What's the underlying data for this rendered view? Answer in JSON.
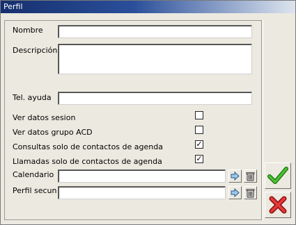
{
  "window": {
    "title": "Perfil"
  },
  "form": {
    "nombre": {
      "label": "Nombre",
      "value": ""
    },
    "descripcion": {
      "label": "Descripción",
      "value": ""
    },
    "tel_ayuda": {
      "label": "Tel. ayuda",
      "value": ""
    },
    "checks": [
      {
        "label": "Ver datos sesion",
        "checked": false,
        "mark": ""
      },
      {
        "label": "Ver datos grupo ACD",
        "checked": false,
        "mark": ""
      },
      {
        "label": "Consultas solo de contactos de agenda",
        "checked": true,
        "mark": "✓"
      },
      {
        "label": "Llamadas solo de contactos de agenda",
        "checked": true,
        "mark": "✓"
      }
    ],
    "calendario": {
      "label": "Calendario",
      "value": ""
    },
    "perfil_secun": {
      "label": "Perfil secun",
      "value": ""
    }
  },
  "icons": {
    "select": "select-arrow-icon",
    "clear": "trash-bin-icon",
    "accept": "green-check-icon",
    "cancel": "red-x-icon"
  },
  "colors": {
    "titlebar_start": "#16306e",
    "titlebar_end": "#dde4ee",
    "accept_green": "#2e9a1e",
    "cancel_red": "#d42020",
    "background": "#ece9e0"
  }
}
